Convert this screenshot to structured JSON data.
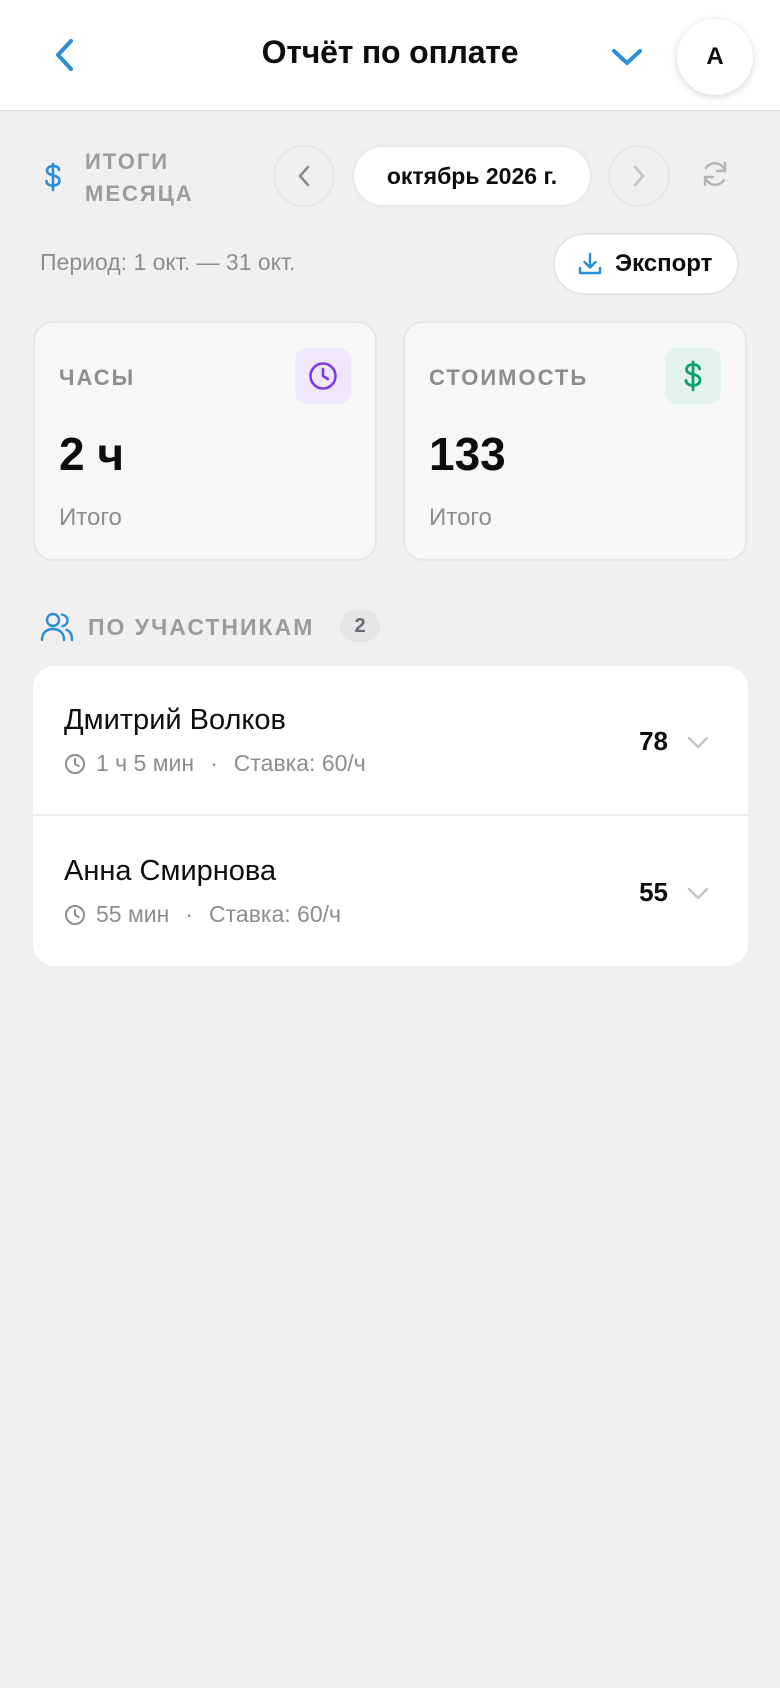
{
  "header": {
    "title": "Отчёт по оплате",
    "avatar_initial": "А"
  },
  "summary": {
    "label": "ИТОГИ МЕСЯЦА",
    "month": "октябрь 2026 г.",
    "period": "Период: 1 окт. — 31 окт.",
    "export_label": "Экспорт"
  },
  "stats": {
    "hours": {
      "label": "ЧАСЫ",
      "value": "2 ч",
      "sub": "Итого"
    },
    "cost": {
      "label": "СТОИМОСТЬ",
      "value": "133",
      "sub": "Итого"
    }
  },
  "participants": {
    "title": "ПО УЧАСТНИКАМ",
    "count": "2",
    "items": [
      {
        "name": "Дмитрий Волков",
        "duration": "1 ч 5 мин",
        "separator": "·",
        "rate": "Ставка: 60/ч",
        "amount": "78"
      },
      {
        "name": "Анна Смирнова",
        "duration": "55 мин",
        "separator": "·",
        "rate": "Ставка: 60/ч",
        "amount": "55"
      }
    ]
  },
  "colors": {
    "accent_blue": "#2a8ed6",
    "purple": "#7c3aed",
    "green": "#0f9f6e",
    "muted": "#8d8d91"
  }
}
